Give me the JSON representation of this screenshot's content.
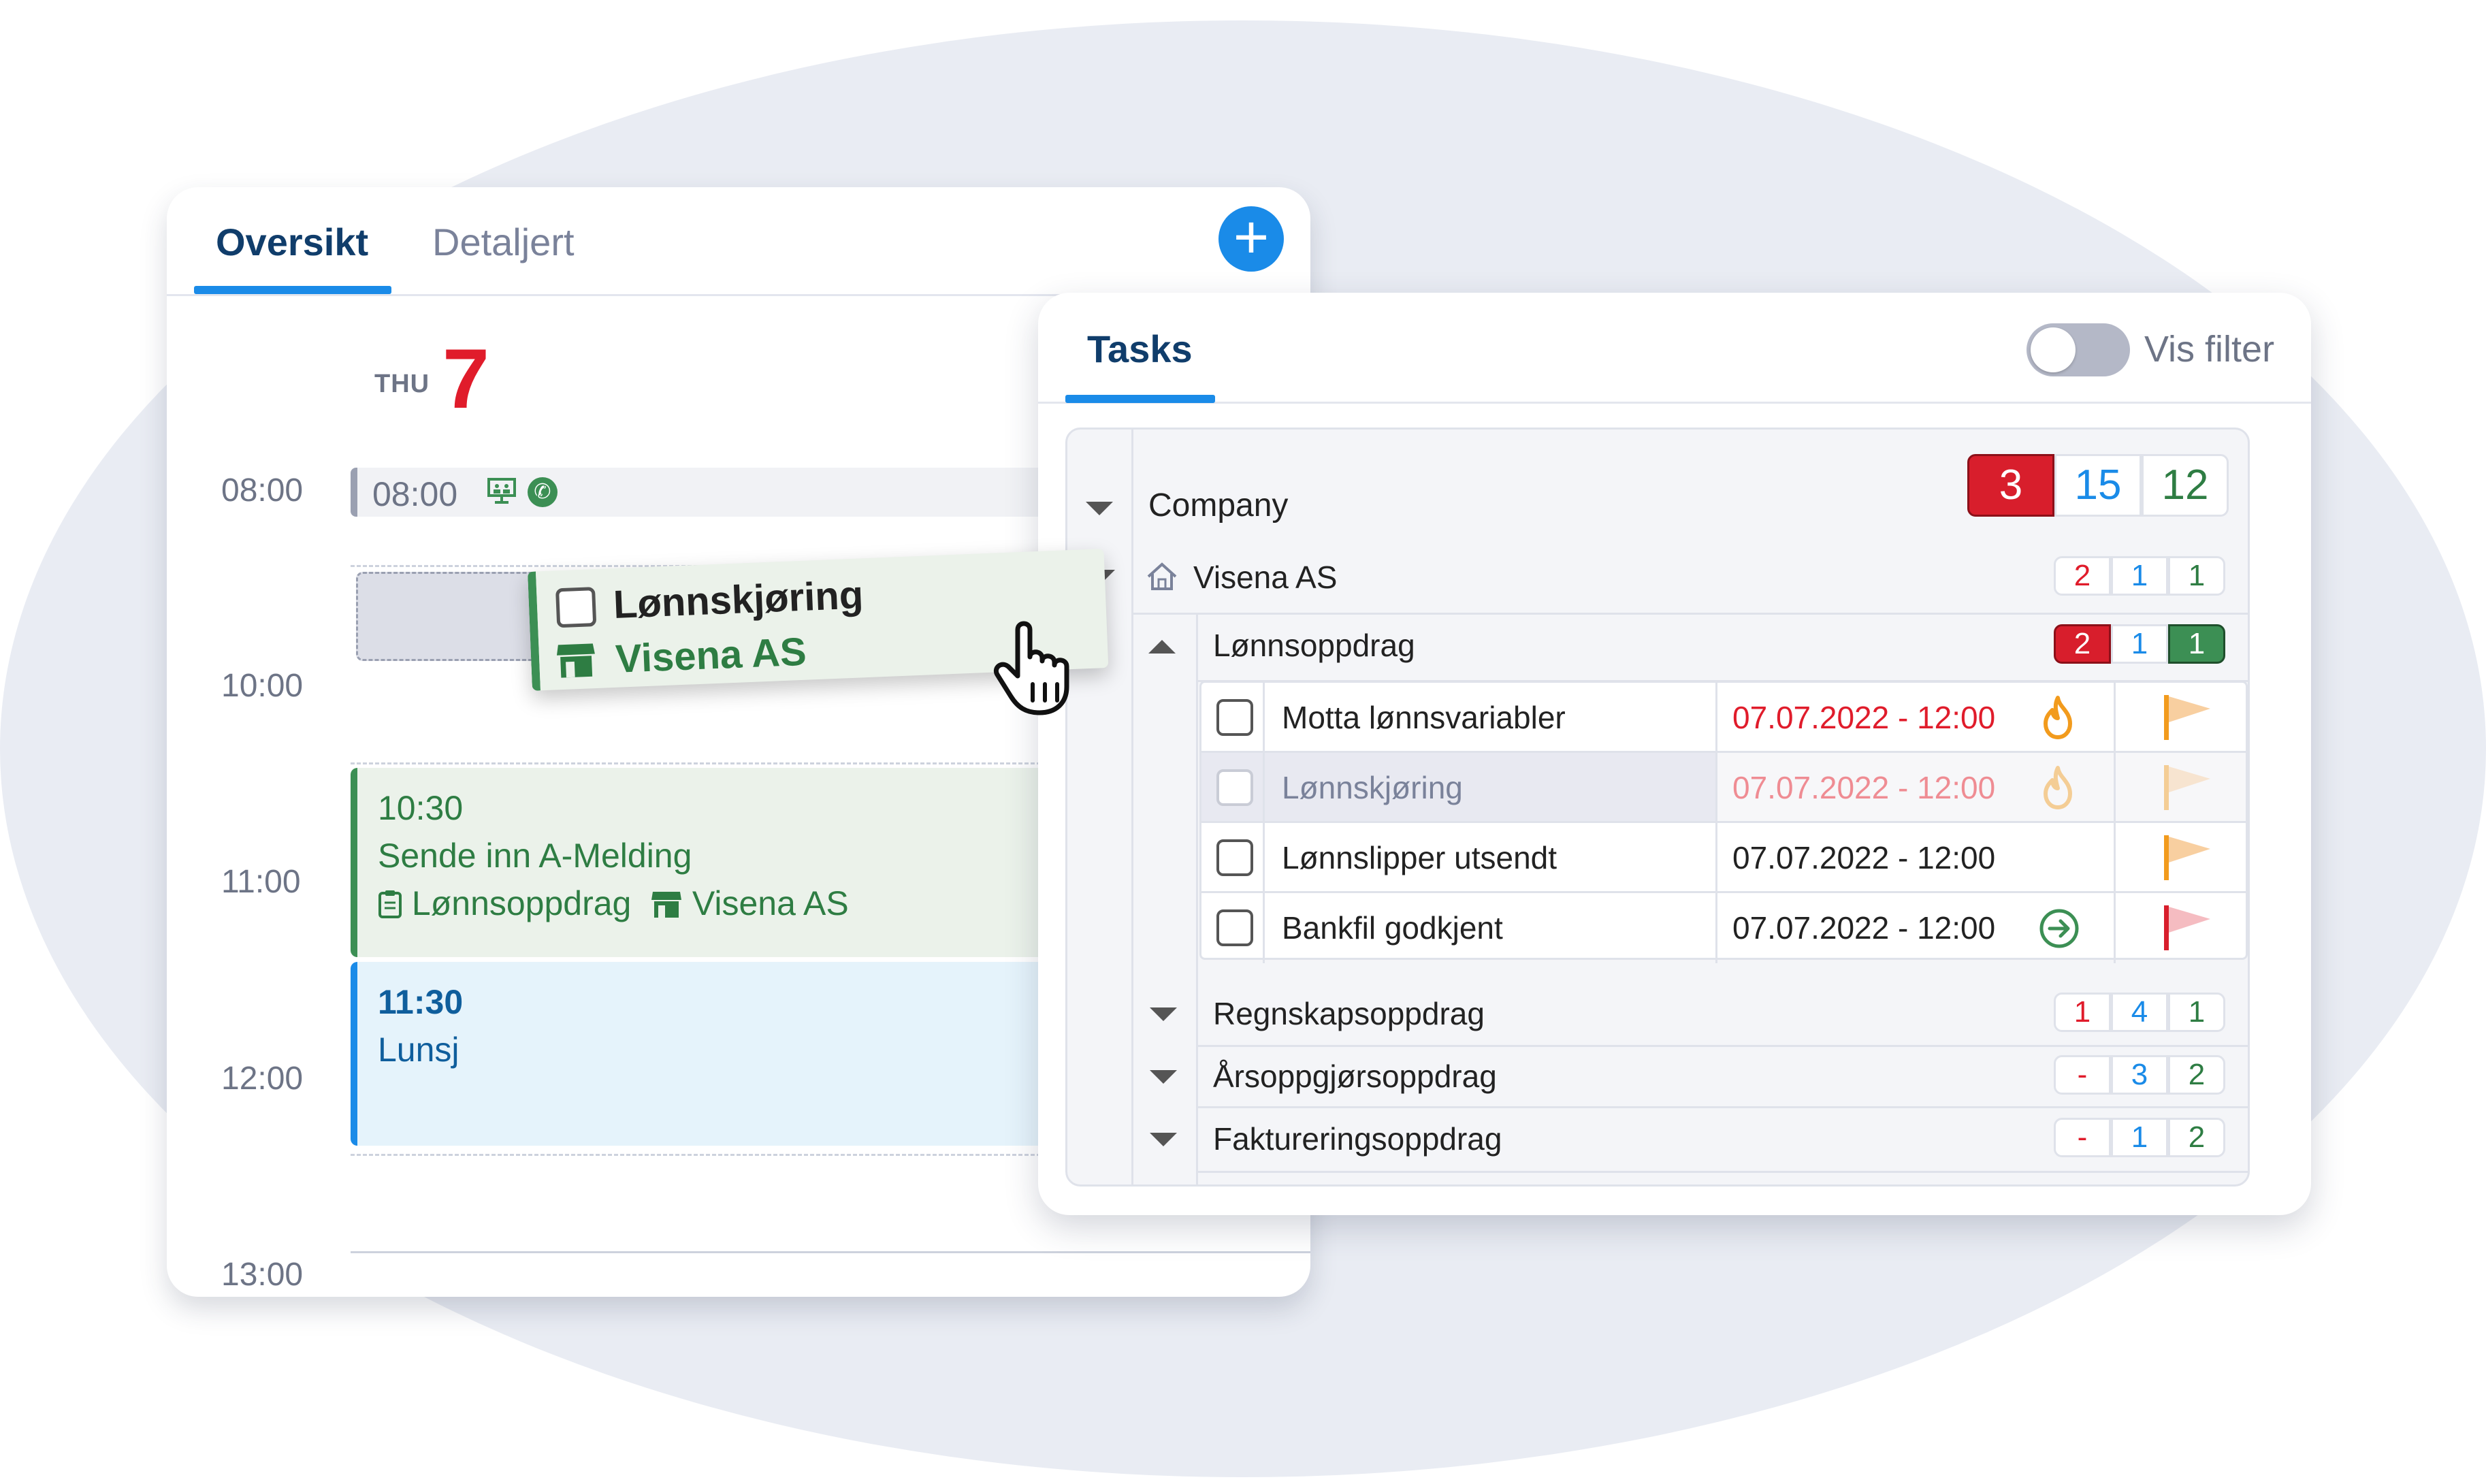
{
  "calendar": {
    "tabs": [
      {
        "label": "Oversikt"
      },
      {
        "label": "Detaljert"
      }
    ],
    "day": {
      "name": "THU",
      "number": "7"
    },
    "times": [
      "08:00",
      "10:00",
      "11:00",
      "12:00",
      "13:00"
    ],
    "events": {
      "e0800": {
        "time": "08:00"
      },
      "e1030": {
        "time": "10:30",
        "title": "Sende inn A-Melding",
        "assignment": "Lønnsoppdrag",
        "company": "Visena AS"
      },
      "e1130": {
        "time": "11:30",
        "title": "Lunsj"
      }
    },
    "dragged": {
      "title": "Lønnskjøring",
      "company": "Visena AS"
    },
    "add_icon": "plus-icon"
  },
  "tasks": {
    "tab": "Tasks",
    "filter_label": "Vis filter",
    "filter_on": false,
    "company_header": {
      "label": "Company",
      "counts": [
        "3",
        "15",
        "12"
      ]
    },
    "company": {
      "name": "Visena AS",
      "counts": [
        "2",
        "1",
        "1"
      ]
    },
    "group_open": {
      "name": "Lønnsoppdrag",
      "counts": [
        "2",
        "1",
        "1"
      ]
    },
    "items": [
      {
        "name": "Motta lønnsvariabler",
        "date": "07.07.2022 - 12:00",
        "overdue": true,
        "status_icon": "fire-icon",
        "flag": "orange"
      },
      {
        "name": "Lønnskjøring",
        "date": "07.07.2022 - 12:00",
        "overdue": true,
        "status_icon": "fire-icon",
        "flag": "orange",
        "faded": true
      },
      {
        "name": "Lønnslipper utsendt",
        "date": "07.07.2022 - 12:00",
        "overdue": false,
        "flag": "orange"
      },
      {
        "name": "Bankfil godkjent",
        "date": "07.07.2022 - 12:00",
        "overdue": false,
        "status_icon": "arrow-right-circle-icon",
        "flag": "red"
      }
    ],
    "groups": [
      {
        "name": "Regnskapsoppdrag",
        "counts": [
          "1",
          "4",
          "1"
        ]
      },
      {
        "name": "Årsoppgjørsoppdrag",
        "counts": [
          "-",
          "3",
          "2"
        ]
      },
      {
        "name": "Faktureringsoppdrag",
        "counts": [
          "-",
          "1",
          "2"
        ]
      }
    ]
  },
  "colors": {
    "accent": "#1a8be8",
    "danger": "#e01c2b",
    "success": "#3c8f54",
    "navy": "#103d6b"
  }
}
